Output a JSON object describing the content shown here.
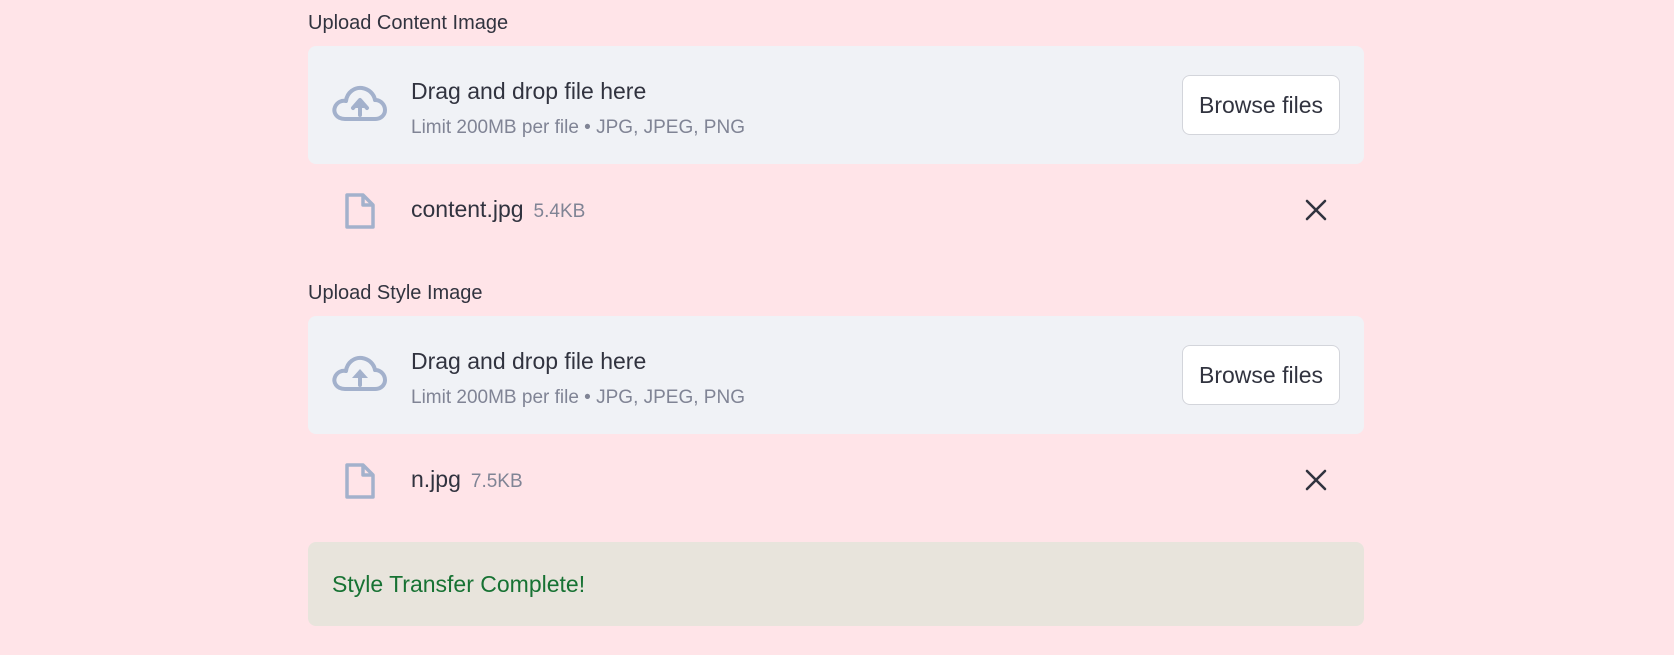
{
  "uploaders": [
    {
      "label": "Upload Content Image",
      "drop_title": "Drag and drop file here",
      "drop_limit": "Limit 200MB per file • JPG, JPEG, PNG",
      "browse_label": "Browse files",
      "file": {
        "name": "content.jpg",
        "size": "5.4KB"
      }
    },
    {
      "label": "Upload Style Image",
      "drop_title": "Drag and drop file here",
      "drop_limit": "Limit 200MB per file • JPG, JPEG, PNG",
      "browse_label": "Browse files",
      "file": {
        "name": "n.jpg",
        "size": "7.5KB"
      }
    }
  ],
  "status": {
    "message": "Style Transfer Complete!",
    "color": "#177233",
    "background": "#e8e4dc"
  },
  "icons": {
    "upload": "cloud-upload-icon",
    "file": "file-icon",
    "remove": "close-icon"
  },
  "colors": {
    "page_background": "#ffe4e8",
    "dropzone_background": "#f0f2f6",
    "icon_color": "#a3b1cc"
  }
}
